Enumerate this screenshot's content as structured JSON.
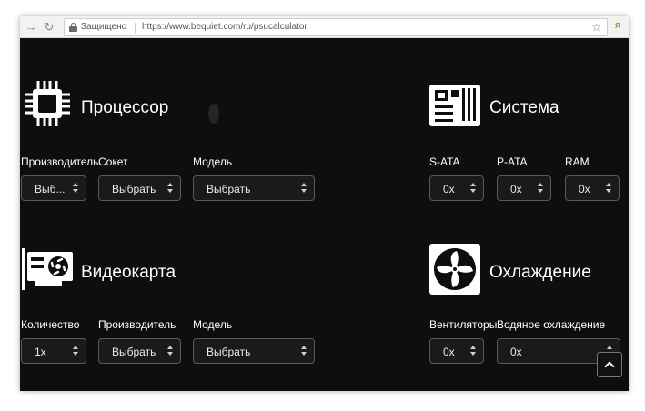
{
  "browser": {
    "secure_label": "Защищено",
    "url": "https://www.bequiet.com/ru/psucalculator",
    "back_icon": "arrow-left-icon",
    "reload_icon": "reload-icon",
    "star_icon": "star-icon"
  },
  "cpu": {
    "title": "Процессор",
    "icon": "cpu-icon",
    "fields": [
      {
        "label": "Производитель",
        "value": "Выб..."
      },
      {
        "label": "Сокет",
        "value": "Выбрать"
      },
      {
        "label": "Модель",
        "value": "Выбрать"
      }
    ]
  },
  "system": {
    "title": "Система",
    "icon": "motherboard-icon",
    "fields": [
      {
        "label": "S-ATA",
        "value": "0x"
      },
      {
        "label": "P-ATA",
        "value": "0x"
      },
      {
        "label": "RAM",
        "value": "0x"
      }
    ]
  },
  "gpu": {
    "title": "Видеокарта",
    "icon": "graphics-card-icon",
    "fields": [
      {
        "label": "Количество",
        "value": "1x"
      },
      {
        "label": "Производитель",
        "value": "Выбрать"
      },
      {
        "label": "Модель",
        "value": "Выбрать"
      }
    ]
  },
  "cooling": {
    "title": "Охлаждение",
    "icon": "fan-icon",
    "fields": [
      {
        "label": "Вентиляторы",
        "value": "0x"
      },
      {
        "label": "Водяное охлаждение",
        "value": "0x"
      }
    ]
  },
  "scroll_top_icon": "chevron-up-icon"
}
